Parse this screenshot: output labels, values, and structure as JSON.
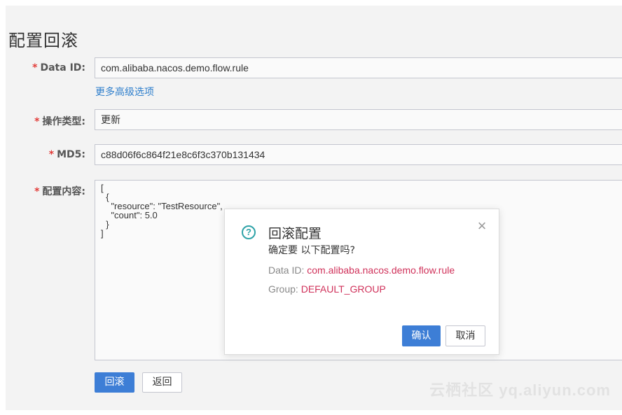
{
  "page": {
    "title": "配置回滚",
    "more_options_link": "更多高级选项",
    "watermark": "云栖社区 yq.aliyun.com"
  },
  "form": {
    "required_mark": "*",
    "data_id": {
      "label": "Data ID:",
      "value": "com.alibaba.nacos.demo.flow.rule"
    },
    "operation_type": {
      "label": "操作类型:",
      "value": "更新"
    },
    "md5": {
      "label": "MD5:",
      "value": "c88d06f6c864f21e8c6f3c370b131434"
    },
    "content": {
      "label": "配置内容:",
      "value": "[\n  {\n    \"resource\": \"TestResource\",\n    \"count\": 5.0\n  }\n]"
    }
  },
  "actions": {
    "rollback_label": "回滚",
    "back_label": "返回"
  },
  "dialog": {
    "title": "回滚配置",
    "subtitle": "确定要 以下配置吗?",
    "data_id_key": "Data ID:",
    "data_id_value": "com.alibaba.nacos.demo.flow.rule",
    "group_key": "Group:",
    "group_value": "DEFAULT_GROUP",
    "confirm_label": "确认",
    "cancel_label": "取消",
    "help_icon": "?",
    "close_icon": "×"
  },
  "colors": {
    "accent": "#3d7ed6",
    "required": "#e23c39",
    "link": "#2f7fcc",
    "highlight_value": "#d0315a",
    "help_icon": "#2fa3a8"
  }
}
